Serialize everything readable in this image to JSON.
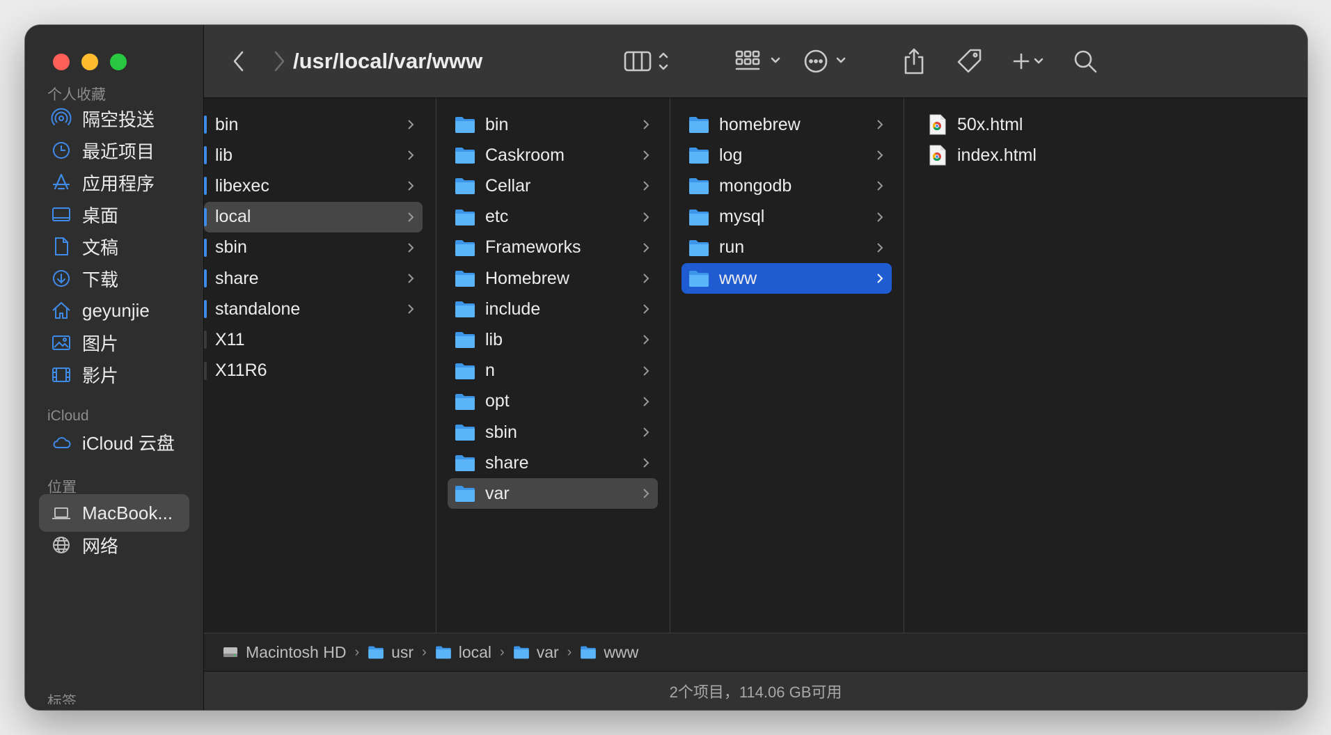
{
  "window": {
    "path_title": "/usr/local/var/www"
  },
  "sidebar": {
    "favorites_header": "个人收藏",
    "favorites": [
      {
        "label": "隔空投送",
        "icon": "airdrop-icon"
      },
      {
        "label": "最近项目",
        "icon": "clock-icon"
      },
      {
        "label": "应用程序",
        "icon": "applications-icon"
      },
      {
        "label": "桌面",
        "icon": "desktop-icon"
      },
      {
        "label": "文稿",
        "icon": "document-icon"
      },
      {
        "label": "下载",
        "icon": "download-icon"
      },
      {
        "label": "geyunjie",
        "icon": "home-icon"
      },
      {
        "label": "图片",
        "icon": "photo-icon"
      },
      {
        "label": "影片",
        "icon": "film-icon"
      }
    ],
    "icloud_header": "iCloud",
    "icloud": [
      {
        "label": "iCloud 云盘",
        "icon": "cloud-icon"
      }
    ],
    "locations_header": "位置",
    "locations": [
      {
        "label": "MacBook...",
        "icon": "laptop-icon",
        "selected": true
      },
      {
        "label": "网络",
        "icon": "globe-icon"
      }
    ],
    "tags_header": "标签"
  },
  "columns": {
    "col1": [
      "bin",
      "lib",
      "libexec",
      "local",
      "sbin",
      "share",
      "standalone",
      "X11",
      "X11R6"
    ],
    "col2": [
      "bin",
      "Caskroom",
      "Cellar",
      "etc",
      "Frameworks",
      "Homebrew",
      "include",
      "lib",
      "n",
      "opt",
      "sbin",
      "share",
      "var"
    ],
    "col3": [
      "homebrew",
      "log",
      "mongodb",
      "mysql",
      "run",
      "www"
    ],
    "col4": [
      "50x.html",
      "index.html"
    ]
  },
  "pathbar": [
    "Macintosh HD",
    "usr",
    "local",
    "var",
    "www"
  ],
  "status": "2个项目，114.06 GB可用",
  "colors": {
    "selection_blue": "#1f5bd1",
    "folder_blue": "#4aa6f2",
    "sidebar_accent": "#3e8bea"
  }
}
